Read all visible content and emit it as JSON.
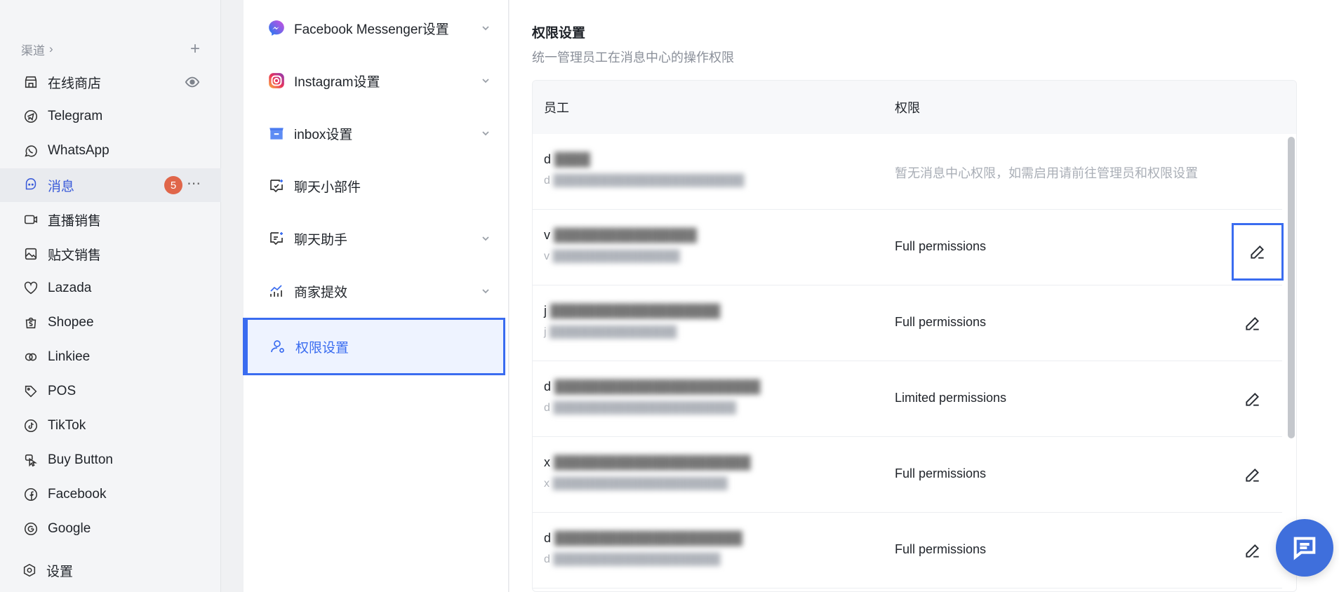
{
  "sidebar": {
    "channels_label": "渠道",
    "items": [
      {
        "label": "在线商店",
        "icon": "store-icon"
      },
      {
        "label": "Telegram",
        "icon": "telegram-icon"
      },
      {
        "label": "WhatsApp",
        "icon": "whatsapp-icon"
      },
      {
        "label": "消息",
        "icon": "message-icon",
        "badge": "5",
        "active": true
      },
      {
        "label": "直播销售",
        "icon": "live-icon"
      },
      {
        "label": "贴文销售",
        "icon": "post-icon"
      },
      {
        "label": "Lazada",
        "icon": "lazada-icon"
      },
      {
        "label": "Shopee",
        "icon": "shopee-icon"
      },
      {
        "label": "Linkiee",
        "icon": "linkiee-icon"
      },
      {
        "label": "POS",
        "icon": "pos-icon"
      },
      {
        "label": "TikTok",
        "icon": "tiktok-icon"
      },
      {
        "label": "Buy Button",
        "icon": "buy-button-icon"
      },
      {
        "label": "Facebook",
        "icon": "facebook-icon"
      },
      {
        "label": "Google",
        "icon": "google-icon"
      }
    ],
    "settings_label": "设置"
  },
  "menu": {
    "items": [
      {
        "label": "Facebook Messenger设置",
        "icon": "messenger-icon",
        "chevron": true
      },
      {
        "label": "Instagram设置",
        "icon": "instagram-icon",
        "chevron": true
      },
      {
        "label": "inbox设置",
        "icon": "inbox-icon",
        "chevron": true
      },
      {
        "label": "聊天小部件",
        "icon": "chat-widget-icon",
        "chevron": false
      },
      {
        "label": "聊天助手",
        "icon": "chat-assistant-icon",
        "chevron": true
      },
      {
        "label": "商家提效",
        "icon": "efficiency-icon",
        "chevron": true
      },
      {
        "label": "权限设置",
        "icon": "user-permission-icon",
        "chevron": false,
        "selected": true
      }
    ]
  },
  "panel": {
    "title": "权限设置",
    "subtitle": "统一管理员工在消息中心的操作权限",
    "columns": {
      "employee": "员工",
      "permission": "权限"
    },
    "rows": [
      {
        "name": "d",
        "email": "d",
        "permission": "暂无消息中心权限，如需启用请前往管理员和权限设置",
        "muted": true,
        "editable": false
      },
      {
        "name": "v",
        "email": "v",
        "permission": "Full permissions",
        "editable": true,
        "focused": true
      },
      {
        "name": "j",
        "email": "j",
        "permission": "Full permissions",
        "editable": true
      },
      {
        "name": "d",
        "email": "d",
        "permission": "Limited permissions",
        "editable": true
      },
      {
        "name": "x",
        "email": "x",
        "permission": "Full permissions",
        "editable": true
      },
      {
        "name": "d",
        "email": "d",
        "permission": "Full permissions",
        "editable": true
      }
    ]
  },
  "colors": {
    "accent": "#3a6cf0",
    "badge": "#e0664a",
    "fab": "#3f6fdc"
  }
}
